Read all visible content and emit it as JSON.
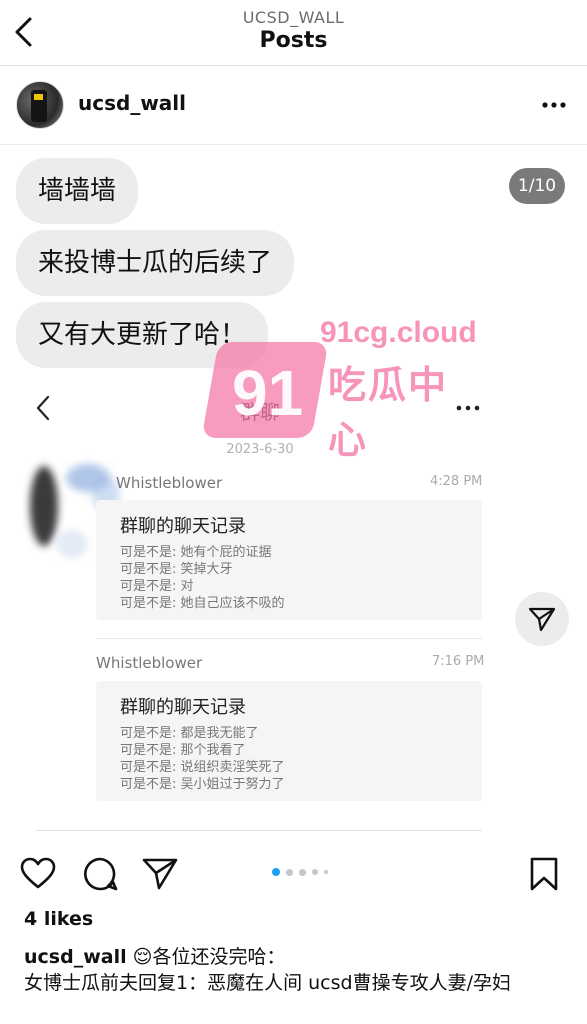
{
  "header": {
    "subtitle": "UCSD_WALL",
    "title": "Posts"
  },
  "post": {
    "username": "ucsd_wall",
    "likes": "4 likes",
    "caption_user": "ucsd_wall",
    "caption_emoji": "😌",
    "caption_text": "各位还没完哈：",
    "caption_line2": "女博士瓜前夫回复1：恶魔在人间 ucsd曹操专攻人妻/孕妇",
    "carousel": {
      "current": 1,
      "total": 10,
      "counter": "1/10"
    }
  },
  "image": {
    "bubbles": [
      "墙墙墙",
      "来投博士瓜的后续了",
      "又有大更新了哈！"
    ],
    "chat": {
      "title": "群聊",
      "date": "2023-6-30",
      "messages": [
        {
          "sender": "Whistleblower",
          "time": "4:28 PM",
          "card_title": "群聊的聊天记录",
          "lines": [
            "可是不是: 她有个屁的证据",
            "可是不是: 笑掉大牙",
            "可是不是: 对",
            "可是不是: 她自己应该不吸的"
          ]
        },
        {
          "sender": "Whistleblower",
          "time": "7:16 PM",
          "card_title": "群聊的聊天记录",
          "lines": [
            "可是不是: 都是我无能了",
            "可是不是: 那个我看了",
            "可是不是: 说组织卖淫笑死了",
            "可是不是: 吴小姐过于努力了"
          ]
        }
      ]
    },
    "watermark": {
      "number": "91",
      "url": "91cg.cloud",
      "brand": "吃瓜中心"
    }
  },
  "colors": {
    "bubble_bg": "#ececec",
    "watermark_pink": "#f47aa9",
    "active_dot": "#1da1f2"
  },
  "icons": [
    "back-icon",
    "more-icon",
    "heart-icon",
    "comment-icon",
    "share-icon",
    "bookmark-icon",
    "send-icon"
  ]
}
